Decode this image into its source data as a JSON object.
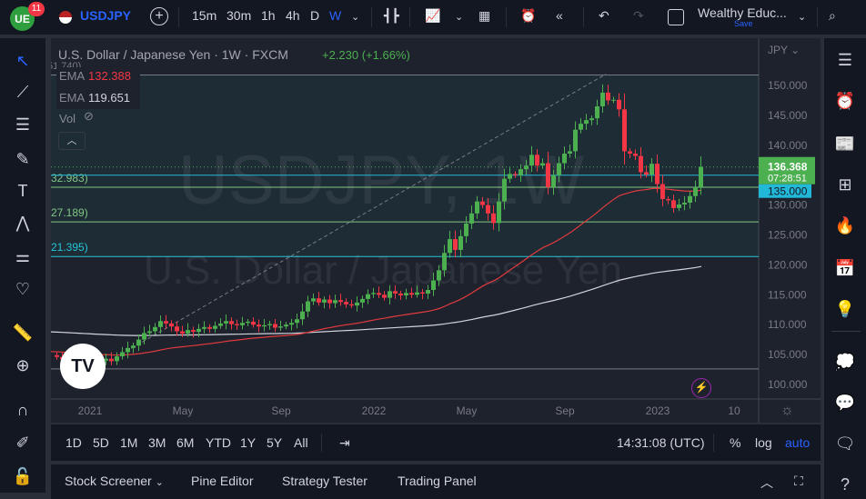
{
  "topbar": {
    "notif_count": "11",
    "symbol": "USDJPY",
    "intervals": [
      "15m",
      "30m",
      "1h",
      "4h",
      "D",
      "W"
    ],
    "active_interval": "W",
    "layout_name": "Wealthy Educ...",
    "save_label": "Save"
  },
  "legend": {
    "title": "U.S. Dollar / Japanese Yen · 1W · FXCM",
    "change": "+2.230 (+1.66%)",
    "ema1_label": "EMA",
    "ema1_value": "132.388",
    "ema2_label": "EMA",
    "ema2_value": "119.651",
    "vol_label": "Vol",
    "top_fib_label": "51.740)"
  },
  "watermark": {
    "line1": "USDJPY, 1W",
    "line2": "U.S. Dollar / Japanese Yen"
  },
  "colors": {
    "up": "#4caf50",
    "down": "#f23645",
    "ema_fast": "#e03a3e",
    "ema_slow": "#d1d4dc",
    "current_price_bg": "#4caf50",
    "alert_bg": "#22b8d8",
    "accent": "#2962ff"
  },
  "chart_data": {
    "type": "candlestick",
    "currency": "JPY",
    "ylim": [
      98,
      153
    ],
    "y_ticks": [
      "150.000",
      "145.000",
      "140.000",
      "135.000",
      "130.000",
      "125.000",
      "120.000",
      "115.000",
      "110.000",
      "105.000",
      "100.000"
    ],
    "y_tick_values": [
      150,
      145,
      140,
      135,
      130,
      125,
      120,
      115,
      110,
      105,
      100
    ],
    "x_ticks": [
      "2021",
      "May",
      "Sep",
      "2022",
      "May",
      "Sep",
      "2023",
      "10"
    ],
    "x_tick_week_index": [
      6,
      23,
      41,
      58,
      75,
      93,
      110,
      124
    ],
    "closes": [
      104.6,
      104.2,
      103.9,
      103.8,
      103.5,
      103.9,
      103.7,
      103.4,
      104.0,
      104.3,
      103.9,
      104.7,
      105.4,
      106.1,
      106.5,
      107.5,
      108.6,
      108.9,
      109.6,
      110.6,
      110.2,
      109.7,
      108.9,
      108.5,
      109.1,
      108.8,
      109.3,
      109.6,
      109.3,
      109.8,
      110.2,
      110.6,
      110.1,
      109.9,
      110.3,
      110.5,
      110.0,
      109.7,
      109.9,
      110.1,
      109.5,
      109.7,
      110.0,
      110.3,
      110.9,
      112.2,
      113.9,
      114.4,
      113.7,
      114.2,
      113.6,
      114.1,
      113.8,
      113.4,
      113.2,
      113.7,
      114.3,
      115.1,
      115.3,
      115.0,
      114.5,
      115.6,
      115.2,
      114.9,
      115.3,
      115.0,
      115.4,
      115.2,
      115.8,
      117.4,
      119.1,
      122.0,
      124.3,
      122.5,
      124.8,
      126.9,
      128.6,
      130.6,
      130.0,
      128.6,
      127.0,
      130.6,
      134.4,
      135.2,
      135.0,
      136.0,
      136.6,
      138.4,
      136.6,
      137.0,
      133.0,
      135.0,
      137.0,
      138.6,
      139.0,
      142.6,
      143.6,
      144.2,
      144.5,
      146.5,
      148.8,
      147.5,
      147.6,
      146.0,
      139.0,
      138.6,
      138.2,
      135.5,
      135.1,
      136.9,
      133.5,
      131.0,
      130.8,
      129.5,
      130.1,
      130.4,
      131.5,
      133.0,
      136.4
    ],
    "ema_fast": {
      "period": 50,
      "seed": 105.5,
      "last": 132.388
    },
    "ema_slow": {
      "period": 200,
      "seed": 108.8,
      "last": 119.651
    },
    "fib_levels": [
      {
        "price": 151.74,
        "label": "51.740)"
      },
      {
        "price": 132.983,
        "label": "32.983)"
      },
      {
        "price": 127.189,
        "label": "27.189)"
      },
      {
        "price": 121.395,
        "label": "21.395)"
      },
      {
        "price": 102.6,
        "label": ""
      }
    ],
    "horizontal_alert": {
      "price": 135.0,
      "label": "135.000"
    },
    "current_price": {
      "price": 136.368,
      "label": "136.368",
      "countdown": "07:28:51"
    }
  },
  "bottombar": {
    "ranges": [
      "1D",
      "5D",
      "1M",
      "3M",
      "6M",
      "YTD",
      "1Y",
      "5Y",
      "All"
    ],
    "clock": "14:31:08 (UTC)",
    "percent": "%",
    "log": "log",
    "auto": "auto"
  },
  "panels": {
    "tabs": [
      "Stock Screener",
      "Pine Editor",
      "Strategy Tester",
      "Trading Panel"
    ]
  }
}
